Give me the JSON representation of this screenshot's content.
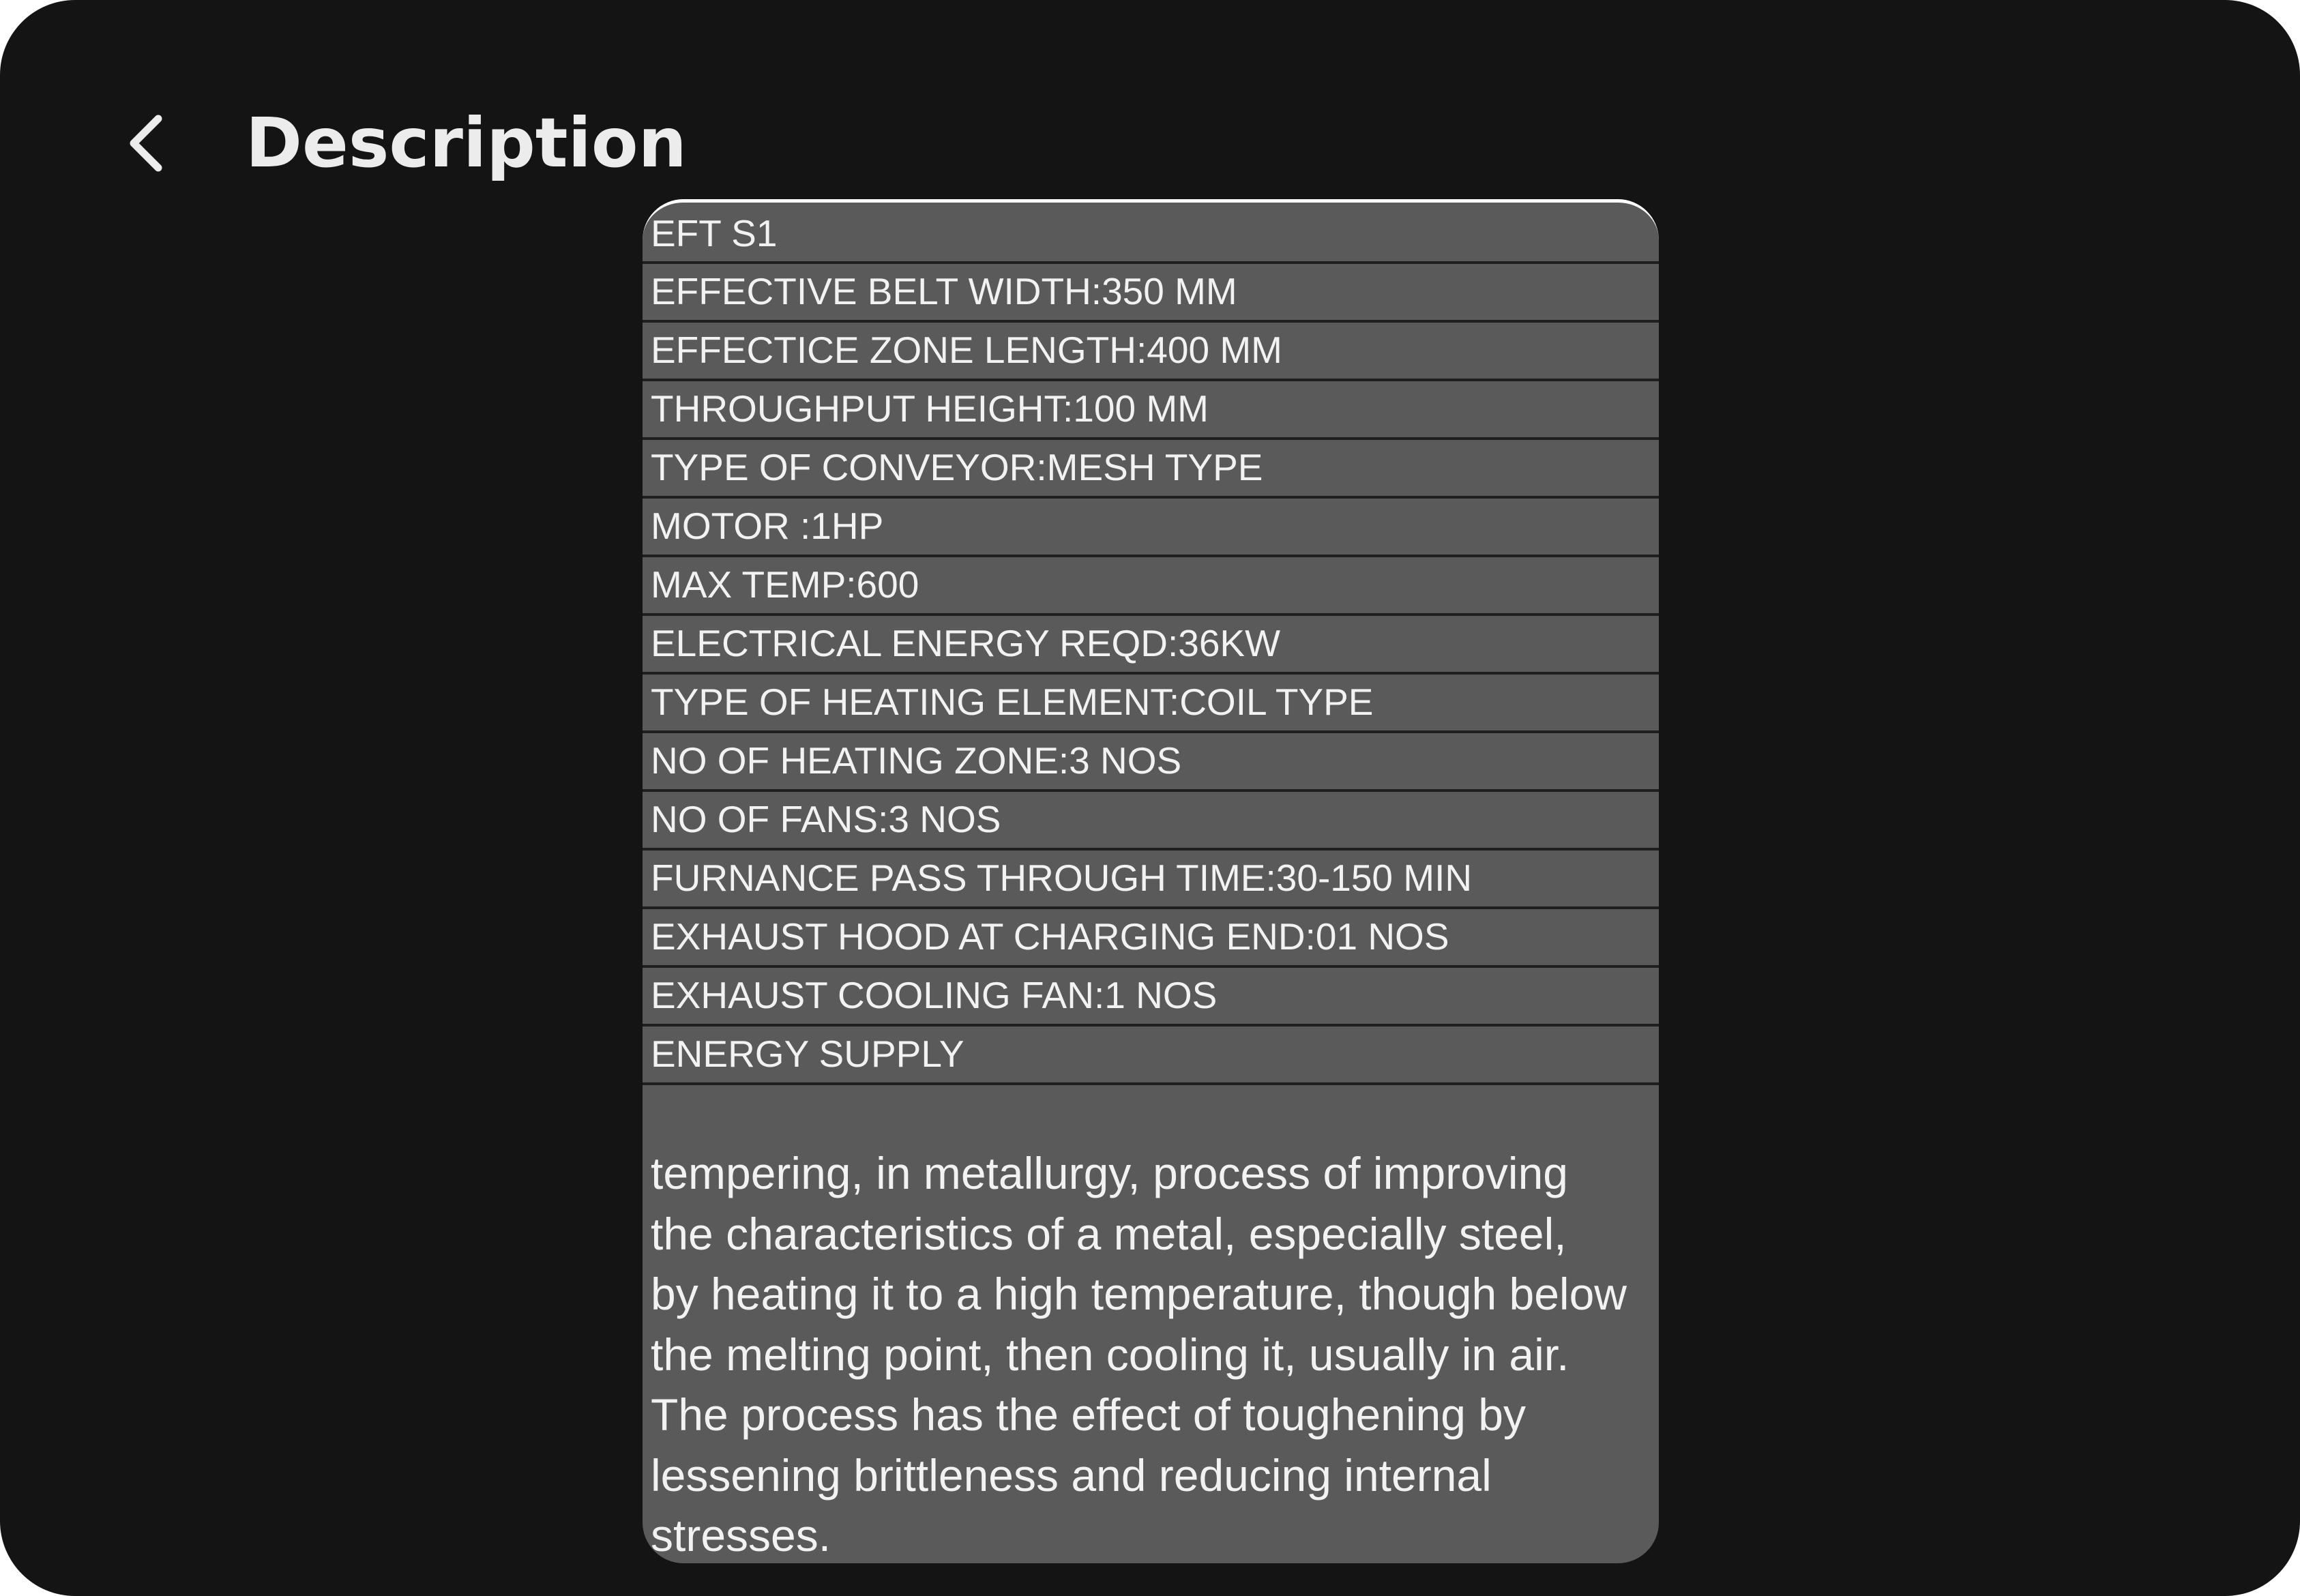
{
  "header": {
    "back_icon": "chevron-left-icon",
    "title": "Description"
  },
  "specs": [
    "EFT S1",
    "EFFECTIVE BELT WIDTH:350 MM",
    "EFFECTICE ZONE LENGTH:400 MM",
    "THROUGHPUT HEIGHT:100 MM",
    "TYPE OF CONVEYOR:MESH TYPE",
    "MOTOR :1HP",
    "MAX TEMP:600",
    "ELECTRICAL ENERGY REQD:36KW",
    "TYPE OF HEATING ELEMENT:COIL TYPE",
    "NO OF HEATING ZONE:3 NOS",
    "NO OF FANS:3 NOS",
    "FURNANCE PASS THROUGH TIME:30-150 MIN",
    "EXHAUST HOOD AT CHARGING END:01 NOS",
    "EXHAUST COOLING FAN:1 NOS",
    "ENERGY SUPPLY"
  ],
  "description": "tempering, in metallurgy, process of improving\nthe characteristics of a metal, especially steel,\nby heating it to a high temperature, though below\nthe melting point, then cooling it, usually in air.\nThe process has the effect of toughening by\nlessening brittleness and reducing internal\nstresses.",
  "colors": {
    "background": "#141414",
    "card": "#5a5a5a",
    "text": "#f2f2f2",
    "row_divider": "#1f1f1f"
  }
}
